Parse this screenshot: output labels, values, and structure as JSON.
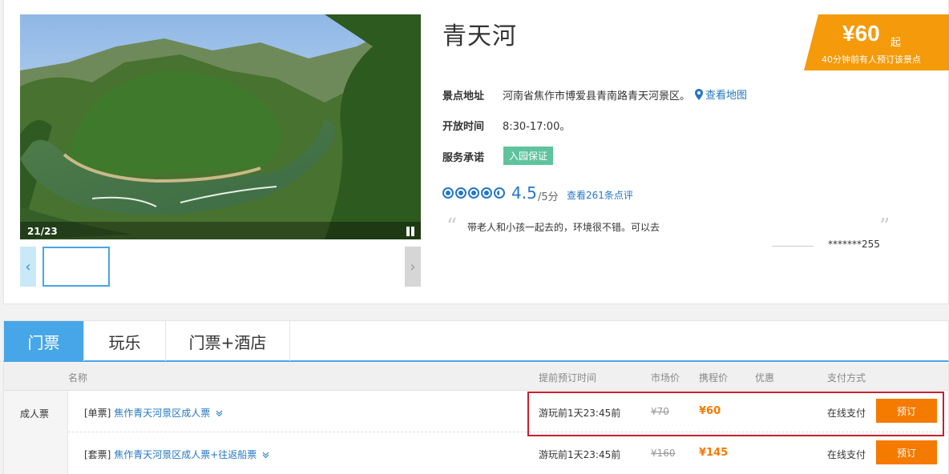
{
  "gallery": {
    "counter": "21/23",
    "prev_arrow": "‹",
    "next_arrow": "›"
  },
  "attraction": {
    "title": "青天河",
    "price": "¥60",
    "price_suffix": "起",
    "recent_booking": "40分钟前有人预订该景点",
    "address_label": "景点地址",
    "address": "河南省焦作市博爱县青南路青天河景区。",
    "map_link": "查看地图",
    "hours_label": "开放时间",
    "hours": "8:30-17:00。",
    "service_label": "服务承诺",
    "service_badge": "入园保证",
    "rating": {
      "score": "4.5",
      "max": "/5分",
      "value": 4.5,
      "out_of": 5,
      "review_link": "查看261条点评"
    },
    "review": {
      "text": "带老人和小孩一起去的，环境很不错。可以去",
      "user": "*******255"
    }
  },
  "tabs": [
    {
      "label": "门票",
      "active": true
    },
    {
      "label": "玩乐",
      "active": false
    },
    {
      "label": "门票+酒店",
      "active": false
    }
  ],
  "table": {
    "headers": {
      "name": "名称",
      "advance": "提前预订时间",
      "market": "市场价",
      "ctrip": "携程价",
      "discount": "优惠",
      "payment": "支付方式"
    },
    "category": "成人票",
    "rows": [
      {
        "tag": "[单票]",
        "name": "焦作青天河景区成人票",
        "advance": "游玩前1天23:45前",
        "market": "¥70",
        "price": "¥60",
        "payment": "在线支付",
        "button": "预订"
      },
      {
        "tag": "[套票]",
        "name": "焦作青天河景区成人票+往返船票",
        "advance": "游玩前1天23:45前",
        "market": "¥160",
        "price": "¥145",
        "payment": "在线支付",
        "button": "预订"
      }
    ]
  },
  "colors": {
    "accent": "#47a6e7",
    "orange": "#f57a00",
    "link": "#2577c4",
    "green_badge": "#5fc39e",
    "highlight": "#c8202f"
  }
}
